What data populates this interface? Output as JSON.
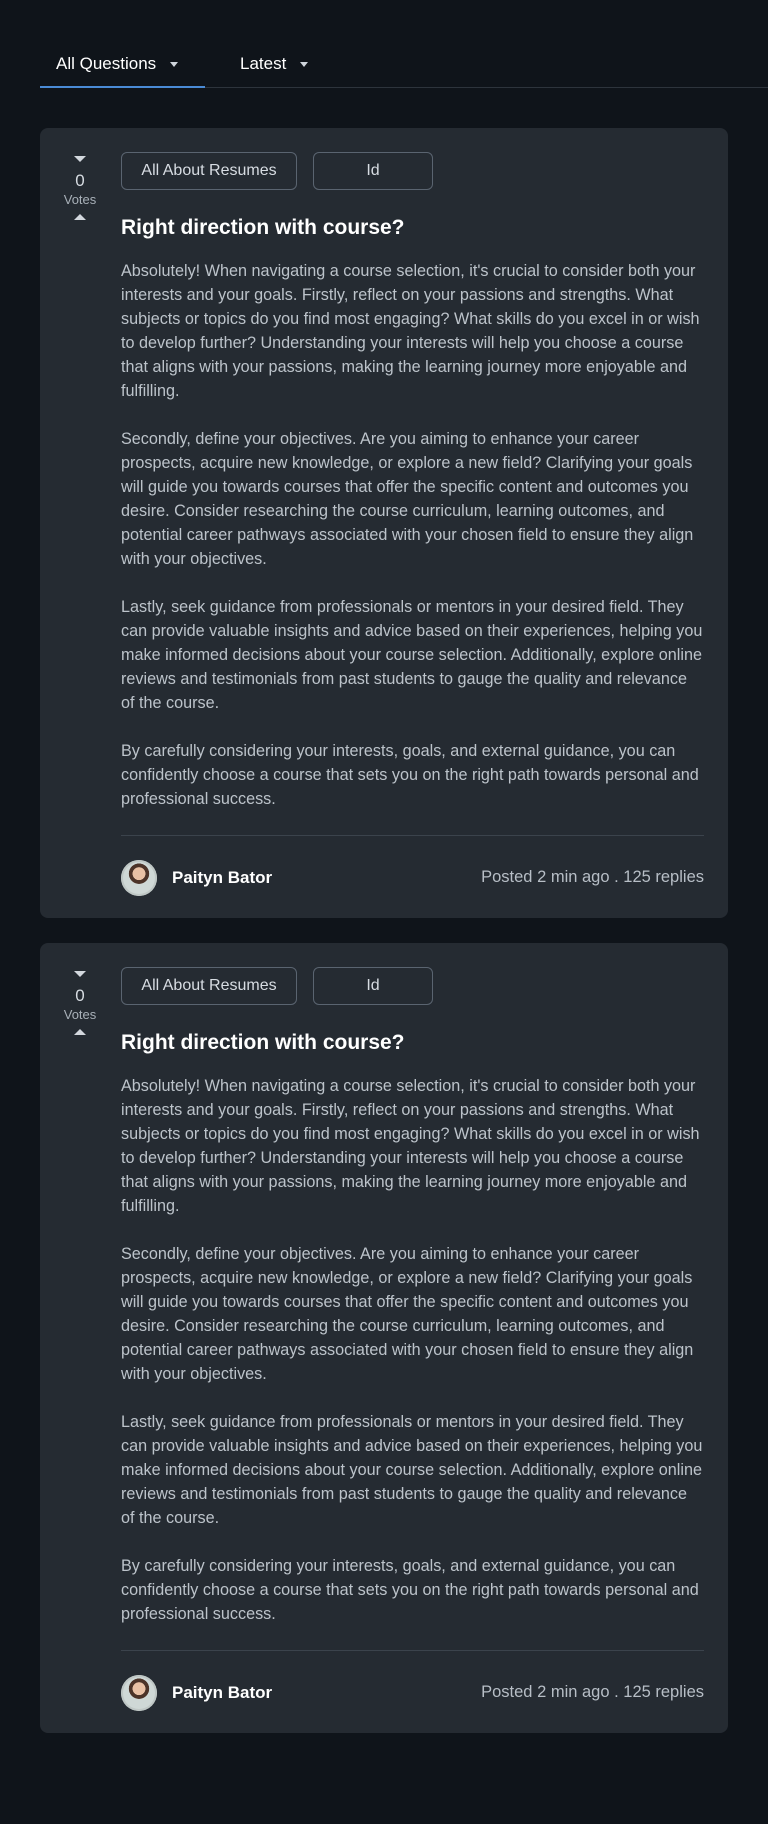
{
  "header": {
    "tabs": [
      {
        "label": "All Questions",
        "active": true
      },
      {
        "label": "Latest",
        "active": false
      }
    ]
  },
  "cards": [
    {
      "votes": {
        "count": "0",
        "label": "Votes"
      },
      "tags": [
        "All About Resumes",
        "Id"
      ],
      "title": "Right direction with course?",
      "paragraphs": [
        "Absolutely! When navigating a course selection, it's crucial to consider both your interests and your goals. Firstly, reflect on your passions and strengths. What subjects or topics do you find most engaging? What skills do you excel in or wish to develop further? Understanding your interests will help you choose a course that aligns with your passions, making the learning journey more enjoyable and fulfilling.",
        "Secondly, define your objectives. Are you aiming to enhance your career prospects, acquire new knowledge, or explore a new field? Clarifying your goals will guide you towards courses that offer the specific content and outcomes you desire. Consider researching the course curriculum, learning outcomes, and potential career pathways associated with your chosen field to ensure they align with your objectives.",
        "Lastly, seek guidance from professionals or mentors in your desired field. They can provide valuable insights and advice based on their experiences, helping you make informed decisions about your course selection. Additionally, explore online reviews and testimonials from past students to gauge the quality and relevance of the course.",
        "By carefully considering your interests, goals, and external guidance, you can confidently choose a course that sets you on the right path towards personal and professional success."
      ],
      "author": "Paityn Bator",
      "meta": "Posted 2 min ago . 125 replies"
    },
    {
      "votes": {
        "count": "0",
        "label": "Votes"
      },
      "tags": [
        "All About Resumes",
        "Id"
      ],
      "title": "Right direction with course?",
      "paragraphs": [
        "Absolutely! When navigating a course selection, it's crucial to consider both your interests and your goals. Firstly, reflect on your passions and strengths. What subjects or topics do you find most engaging? What skills do you excel in or wish to develop further? Understanding your interests will help you choose a course that aligns with your passions, making the learning journey more enjoyable and fulfilling.",
        "Secondly, define your objectives. Are you aiming to enhance your career prospects, acquire new knowledge, or explore a new field? Clarifying your goals will guide you towards courses that offer the specific content and outcomes you desire. Consider researching the course curriculum, learning outcomes, and potential career pathways associated with your chosen field to ensure they align with your objectives.",
        "Lastly, seek guidance from professionals or mentors in your desired field. They can provide valuable insights and advice based on their experiences, helping you make informed decisions about your course selection. Additionally, explore online reviews and testimonials from past students to gauge the quality and relevance of the course.",
        "By carefully considering your interests, goals, and external guidance, you can confidently choose a course that sets you on the right path towards personal and professional success."
      ],
      "author": "Paityn Bator",
      "meta": "Posted 2 min ago . 125 replies"
    }
  ]
}
